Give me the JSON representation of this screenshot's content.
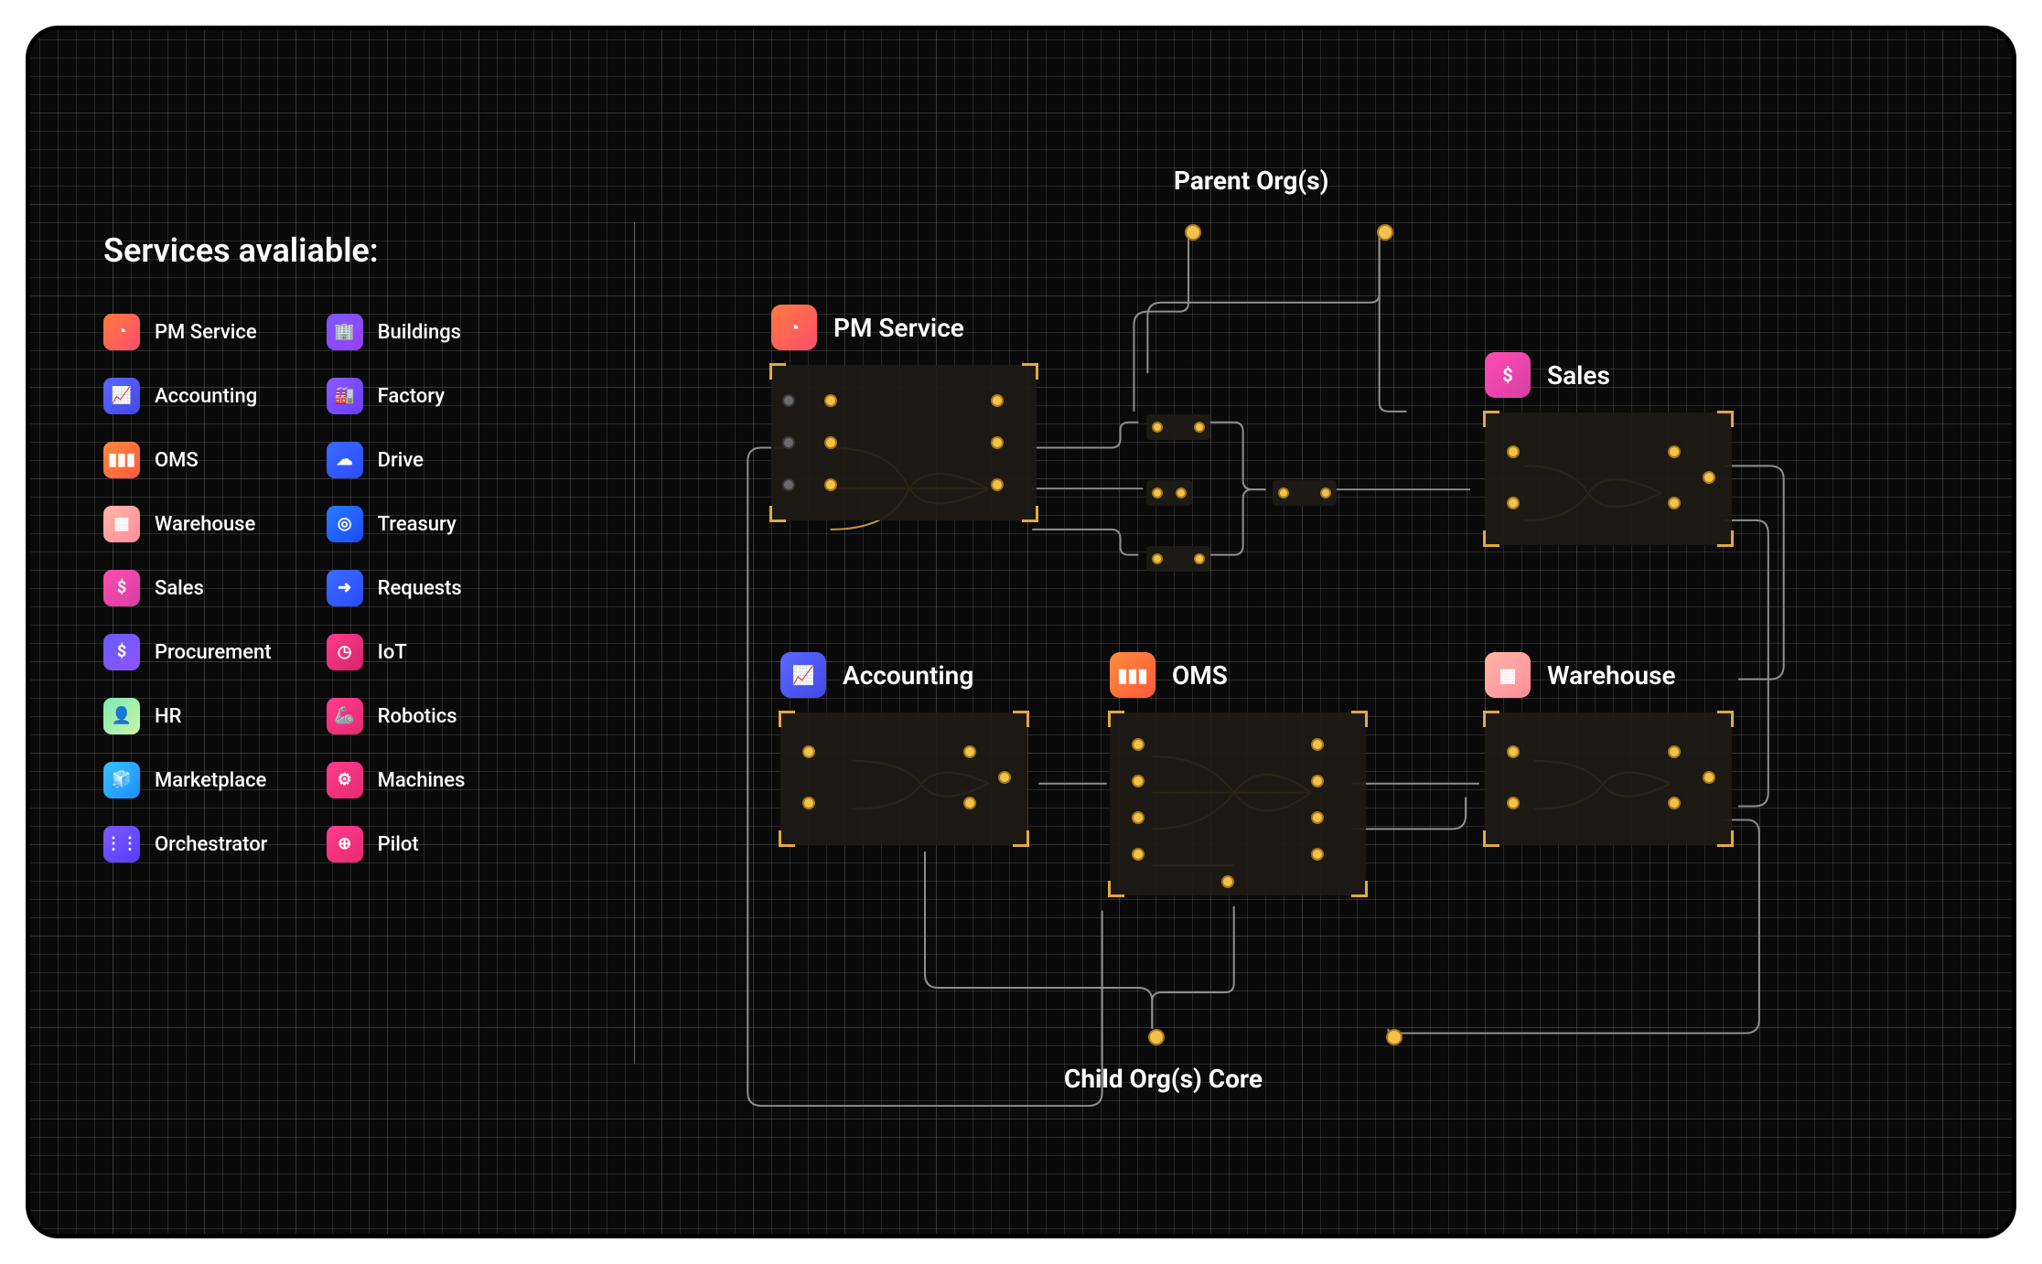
{
  "sidebar": {
    "title": "Services avaliable:",
    "left": [
      {
        "label": "PM Service",
        "slug": "pm-service",
        "color": "linear-gradient(135deg,#ff7a3c,#ff4d6d)",
        "glyph": "◔"
      },
      {
        "label": "Accounting",
        "slug": "accounting",
        "color": "linear-gradient(135deg,#5b67ff,#4348e6)",
        "glyph": "📈"
      },
      {
        "label": "OMS",
        "slug": "oms",
        "color": "linear-gradient(135deg,#ff8a3c,#ff5a3c)",
        "glyph": "▮▮▮"
      },
      {
        "label": "Warehouse",
        "slug": "warehouse",
        "color": "linear-gradient(135deg,#ffb5a8,#ff8d9a)",
        "glyph": "▦"
      },
      {
        "label": "Sales",
        "slug": "sales",
        "color": "linear-gradient(135deg,#ff4db0,#d63fa6)",
        "glyph": "$"
      },
      {
        "label": "Procurement",
        "slug": "procurement",
        "color": "linear-gradient(135deg,#6a5bff,#8f54ff)",
        "glyph": "$"
      },
      {
        "label": "HR",
        "slug": "hr",
        "color": "linear-gradient(135deg,#7fe8b4,#c9f7a5)",
        "glyph": "👤"
      },
      {
        "label": "Marketplace",
        "slug": "marketplace",
        "color": "linear-gradient(135deg,#36c2ff,#1e8dff)",
        "glyph": "🧊"
      },
      {
        "label": "Orchestrator",
        "slug": "orchestrator",
        "color": "linear-gradient(135deg,#7a5bff,#5a3cff)",
        "glyph": "⋮⋮"
      }
    ],
    "right": [
      {
        "label": "Buildings",
        "slug": "buildings",
        "color": "linear-gradient(135deg,#7a5bff,#9a3cff)",
        "glyph": "🏢"
      },
      {
        "label": "Factory",
        "slug": "factory",
        "color": "linear-gradient(135deg,#8a5bff,#6a3cff)",
        "glyph": "🏭"
      },
      {
        "label": "Drive",
        "slug": "drive",
        "color": "linear-gradient(135deg,#3b6bff,#2a4cff)",
        "glyph": "☁"
      },
      {
        "label": "Treasury",
        "slug": "treasury",
        "color": "linear-gradient(135deg,#2b7bff,#1a4cff)",
        "glyph": "◎"
      },
      {
        "label": "Requests",
        "slug": "requests",
        "color": "linear-gradient(135deg,#3b6bff,#2a4cff)",
        "glyph": "➜"
      },
      {
        "label": "IoT",
        "slug": "iot",
        "color": "linear-gradient(135deg,#ff3c8a,#d6246a)",
        "glyph": "◷"
      },
      {
        "label": "Robotics",
        "slug": "robotics",
        "color": "linear-gradient(135deg,#ff3c8a,#e62a72)",
        "glyph": "🦾"
      },
      {
        "label": "Machines",
        "slug": "machines",
        "color": "linear-gradient(135deg,#ff3c8a,#e62a72)",
        "glyph": "⚙"
      },
      {
        "label": "Pilot",
        "slug": "pilot",
        "color": "linear-gradient(135deg,#ff3c8a,#e62a72)",
        "glyph": "⊕"
      }
    ]
  },
  "diagram": {
    "parent_label": "Parent Org(s)",
    "child_label": "Child Org(s) Core",
    "nodes": {
      "pm": {
        "title": "PM Service",
        "slug": "pm-service",
        "color": "linear-gradient(135deg,#ff7a3c,#ff4d6d)",
        "glyph": "◔"
      },
      "sales": {
        "title": "Sales",
        "slug": "sales",
        "color": "linear-gradient(135deg,#ff4db0,#d63fa6)",
        "glyph": "$"
      },
      "accounting": {
        "title": "Accounting",
        "slug": "accounting",
        "color": "linear-gradient(135deg,#5b67ff,#4348e6)",
        "glyph": "📈"
      },
      "oms": {
        "title": "OMS",
        "slug": "oms",
        "color": "linear-gradient(135deg,#ff8a3c,#ff5a3c)",
        "glyph": "▮▮▮"
      },
      "warehouse": {
        "title": "Warehouse",
        "slug": "warehouse",
        "color": "linear-gradient(135deg,#ffb5a8,#ff8d9a)",
        "glyph": "▦"
      }
    }
  },
  "colors": {
    "accent": "#f2c34b",
    "wire": "#9a9a9a"
  }
}
